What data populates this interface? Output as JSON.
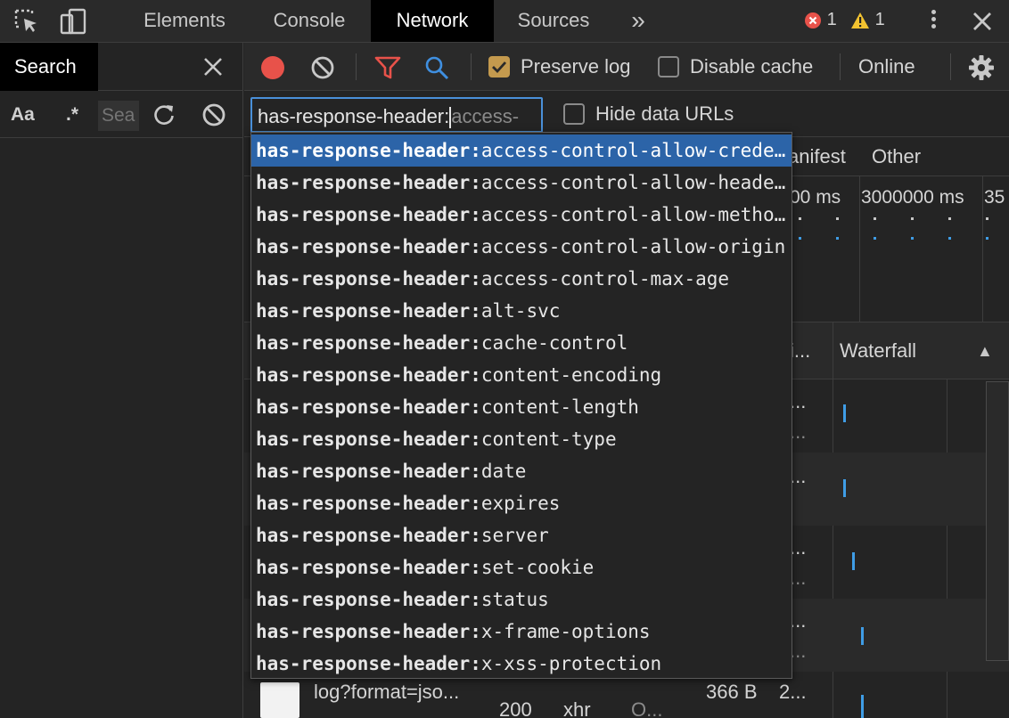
{
  "topbar": {
    "tabs": [
      {
        "label": "Elements"
      },
      {
        "label": "Console"
      },
      {
        "label": "Network"
      },
      {
        "label": "Sources"
      }
    ],
    "more_label": "»",
    "error_count": "1",
    "warning_count": "1"
  },
  "search_panel": {
    "tab_label": "Search",
    "aa_label": "Aa",
    "regex_label": ".*",
    "input_placeholder": "Sea"
  },
  "toolbar": {
    "preserve_log_label": "Preserve log",
    "preserve_log_checked": true,
    "disable_cache_label": "Disable cache",
    "disable_cache_checked": false,
    "throttle_label": "Online"
  },
  "filter": {
    "typed": "has-response-header:",
    "ghost": "access-",
    "hide_data_urls_label": "Hide data URLs",
    "hide_data_urls_checked": false
  },
  "types": {
    "manifest_partial": "anifest",
    "other": "Other"
  },
  "overview": {
    "tick_labels": [
      "00 ms",
      "3000000 ms",
      "35"
    ]
  },
  "table": {
    "header_truncated": "i...",
    "waterfall_label": "Waterfall",
    "sort_glyph": "▲",
    "rows": [
      {
        "c1": "...",
        "c2": "..."
      },
      {
        "c1": "...",
        "c2": ""
      },
      {
        "c1": "...",
        "c2": "..."
      },
      {
        "c1": "...",
        "c2": "..."
      }
    ],
    "last_row": {
      "name": "log?format=jso...",
      "status": "200",
      "type": "xhr",
      "initiator": "O...",
      "size": "366 B",
      "time": "2..."
    }
  },
  "suggestions": {
    "prefix": "has-response-header:",
    "items": [
      {
        "suffix": "access-control-allow-credentials",
        "selected": true
      },
      {
        "suffix": "access-control-allow-headers",
        "selected": false
      },
      {
        "suffix": "access-control-allow-methods",
        "selected": false
      },
      {
        "suffix": "access-control-allow-origin",
        "selected": false
      },
      {
        "suffix": "access-control-max-age",
        "selected": false
      },
      {
        "suffix": "alt-svc",
        "selected": false
      },
      {
        "suffix": "cache-control",
        "selected": false
      },
      {
        "suffix": "content-encoding",
        "selected": false
      },
      {
        "suffix": "content-length",
        "selected": false
      },
      {
        "suffix": "content-type",
        "selected": false
      },
      {
        "suffix": "date",
        "selected": false
      },
      {
        "suffix": "expires",
        "selected": false
      },
      {
        "suffix": "server",
        "selected": false
      },
      {
        "suffix": "set-cookie",
        "selected": false
      },
      {
        "suffix": "status",
        "selected": false
      },
      {
        "suffix": "x-frame-options",
        "selected": false
      },
      {
        "suffix": "x-xss-protection",
        "selected": false
      }
    ]
  },
  "colors": {
    "record": "#e8524a",
    "filter_icon": "#e8524a",
    "search_icon": "#3f8fe0",
    "selection": "#2c64a8",
    "waterfall_bar": "#3f9de6",
    "error": "#e8524a",
    "warning": "#f2c230"
  }
}
